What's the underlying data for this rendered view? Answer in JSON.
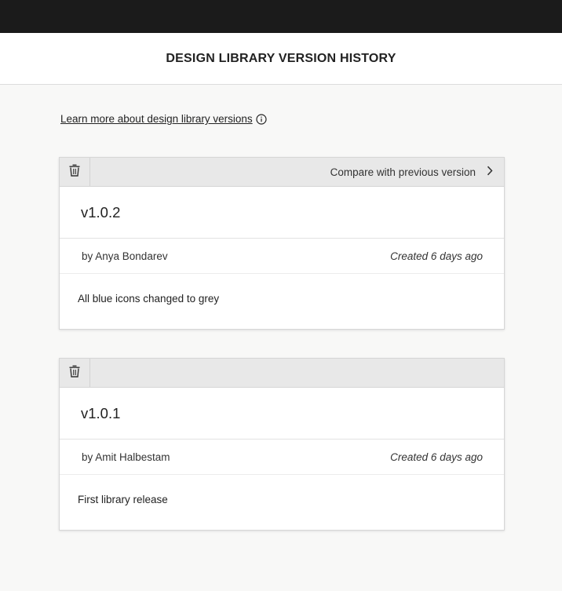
{
  "header": {
    "title": "DESIGN LIBRARY VERSION HISTORY"
  },
  "learn_more": {
    "label": "Learn more about design library versions",
    "icon": "info-circle-icon"
  },
  "versions": [
    {
      "version": "v1.0.2",
      "author": "by Anya Bondarev",
      "created": "Created 6 days ago",
      "description": "All blue icons changed to grey",
      "compare_label": "Compare with previous version"
    },
    {
      "version": "v1.0.1",
      "author": "by Amit Halbestam",
      "created": "Created 6 days ago",
      "description": "First library release"
    }
  ],
  "colors": {
    "topbar": "#1b1b1b",
    "background": "#f8f8f7",
    "toolbar": "#e8e8e8"
  }
}
